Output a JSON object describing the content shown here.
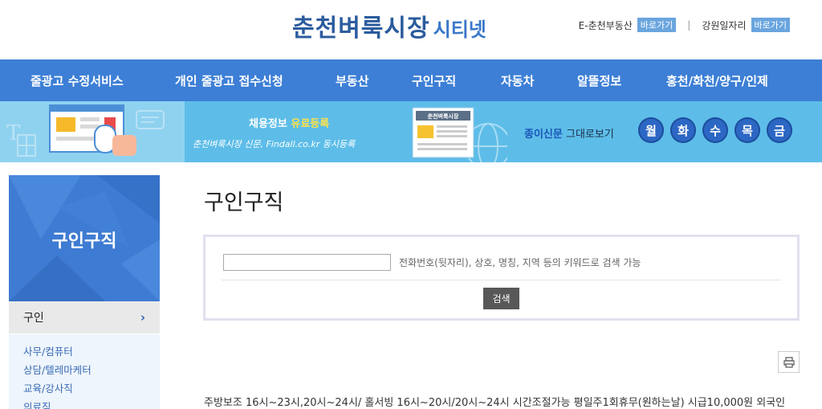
{
  "header": {
    "logo_main": "춘천벼룩시장",
    "logo_sub": "시티넷",
    "links": [
      {
        "label": "E-춘천부동산",
        "go": "바로가기"
      },
      {
        "label": "강원일자리",
        "go": "바로가기"
      }
    ]
  },
  "nav": {
    "items": [
      "줄광고 수정서비스",
      "개인 줄광고 접수신청",
      "부동산",
      "구인구직",
      "자동차",
      "알뜰정보",
      "홍천/화천/양구/인제"
    ]
  },
  "banner": {
    "promo_prefix": "채용정보",
    "promo_highlight": "유료등록",
    "promo_sub": "춘천벼룩시장 신문, Findall.co.kr 동시등록",
    "paper_label": "춘천벼룩시장",
    "paper_text_blue": "종이신문",
    "paper_text_rest": "그대로보기",
    "days": [
      "월",
      "화",
      "수",
      "목",
      "금"
    ]
  },
  "sidebar": {
    "title": "구인구직",
    "active": "구인",
    "active_chevron": "›",
    "items": [
      "사무/컴퓨터",
      "상담/텔레마케터",
      "교육/강사직",
      "의료직"
    ]
  },
  "main": {
    "title": "구인구직",
    "search": {
      "input_value": "",
      "hint": "전화번호(뒷자리), 상호, 명칭, 지역 등의 키워드로 검색 가능",
      "button": "검색"
    },
    "listing": "주방보조 16시~23시,20시~24시/ 홀서빙 16시~20시/20시~24시 시간조절가능 평일주1회휴무(원하는날) 시급10,000원 외국인"
  },
  "colors": {
    "nav_bg": "#3d7fd6",
    "banner_bg": "#5dbde8",
    "sidebar_bg": "#3e7bd2",
    "logo": "#2b5c9e",
    "go_badge": "#6aa5de"
  }
}
